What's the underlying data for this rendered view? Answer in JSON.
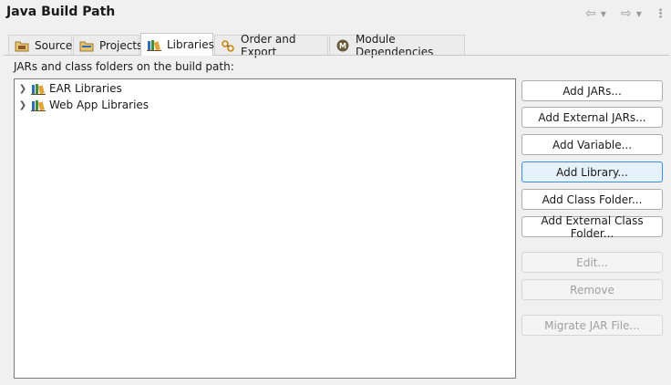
{
  "header": {
    "title": "Java Build Path",
    "nav_back_icon": "arrow-left-icon",
    "nav_forward_icon": "arrow-right-icon",
    "menu_icon": "vertical-ellipsis-icon"
  },
  "tabs": [
    {
      "label": "Source",
      "icon": "source-folder-icon",
      "active": false
    },
    {
      "label": "Projects",
      "icon": "project-folder-icon",
      "active": false
    },
    {
      "label": "Libraries",
      "icon": "library-icon",
      "active": true
    },
    {
      "label": "Order and Export",
      "icon": "order-export-icon",
      "active": false
    },
    {
      "label": "Module Dependencies",
      "icon": "module-icon",
      "active": false
    }
  ],
  "libraries": {
    "section_label": "JARs and class folders on the build path:",
    "items": [
      {
        "label": "EAR Libraries",
        "icon": "library-icon",
        "expandable": true
      },
      {
        "label": "Web App Libraries",
        "icon": "library-icon",
        "expandable": true
      }
    ]
  },
  "buttons": [
    {
      "label": "Add JARs...",
      "enabled": true
    },
    {
      "label": "Add External JARs...",
      "enabled": true
    },
    {
      "label": "Add Variable...",
      "enabled": true
    },
    {
      "label": "Add Library...",
      "enabled": true,
      "focused": true
    },
    {
      "label": "Add Class Folder...",
      "enabled": true
    },
    {
      "label": "Add External Class Folder...",
      "enabled": true
    },
    {
      "label": "Edit...",
      "enabled": false
    },
    {
      "label": "Remove",
      "enabled": false
    },
    {
      "label": "Migrate JAR File...",
      "enabled": false
    }
  ],
  "colors": {
    "library_books": [
      "#2f6fb5",
      "#e0a43a",
      "#3f8f3f"
    ],
    "folder_fill": "#e6c370",
    "module_icon": "#6a5a3a",
    "focus_border": "#3a8ee6"
  }
}
